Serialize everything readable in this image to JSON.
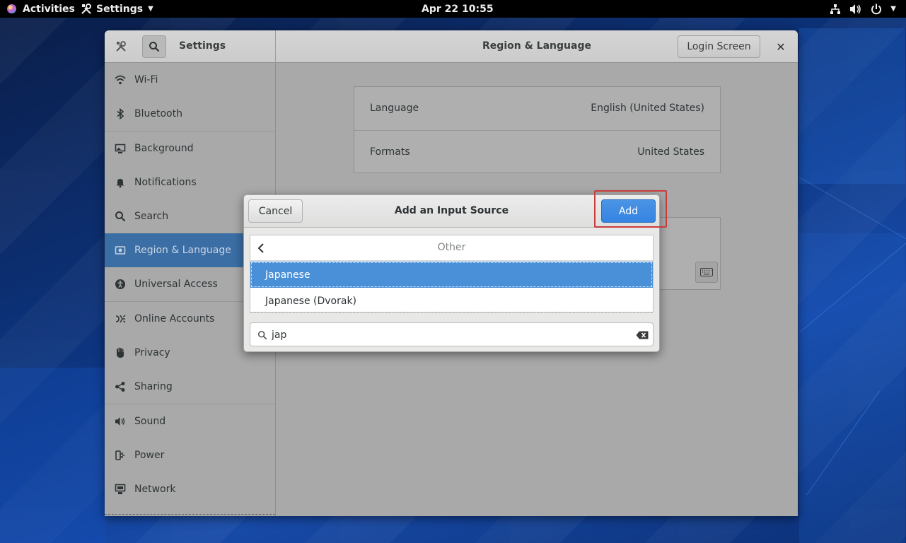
{
  "topbar": {
    "activities": "Activities",
    "app_menu": "Settings",
    "clock": "Apr 22  10:55",
    "icons": [
      "network-wired-icon",
      "volume-icon",
      "power-icon",
      "chevron-down-icon"
    ]
  },
  "window": {
    "sidebar_title": "Settings",
    "panel_title": "Region & Language",
    "login_screen_label": "Login Screen",
    "close_label": "✕"
  },
  "sidebar": {
    "items": [
      {
        "label": "Wi-Fi",
        "icon": "wifi-icon"
      },
      {
        "label": "Bluetooth",
        "icon": "bluetooth-icon"
      },
      {
        "label": "Background",
        "icon": "background-icon"
      },
      {
        "label": "Notifications",
        "icon": "bell-icon"
      },
      {
        "label": "Search",
        "icon": "search-icon"
      },
      {
        "label": "Region & Language",
        "icon": "region-icon",
        "active": true
      },
      {
        "label": "Universal Access",
        "icon": "accessibility-icon"
      },
      {
        "label": "Online Accounts",
        "icon": "online-accounts-icon"
      },
      {
        "label": "Privacy",
        "icon": "hand-icon"
      },
      {
        "label": "Sharing",
        "icon": "share-icon"
      },
      {
        "label": "Sound",
        "icon": "speaker-icon"
      },
      {
        "label": "Power",
        "icon": "power-plug-icon"
      },
      {
        "label": "Network",
        "icon": "network-icon"
      }
    ]
  },
  "main": {
    "language_label": "Language",
    "language_value": "English (United States)",
    "formats_label": "Formats",
    "formats_value": "United States"
  },
  "dialog": {
    "title": "Add an Input Source",
    "cancel_label": "Cancel",
    "add_label": "Add",
    "list_header": "Other",
    "options": [
      {
        "label": "Japanese",
        "selected": true
      },
      {
        "label": "Japanese (Dvorak)",
        "selected": false
      }
    ],
    "search_value": "jap"
  },
  "colors": {
    "accent": "#3584e4",
    "selection": "#4a90d9",
    "highlight_box": "#c83c3c",
    "sidebar_active": "#3b6ea5"
  }
}
